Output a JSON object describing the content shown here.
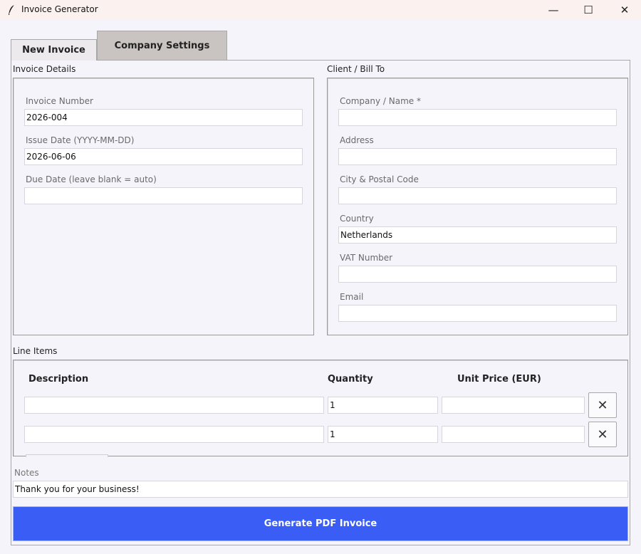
{
  "window": {
    "title": "Invoice Generator",
    "minimize_glyph": "—",
    "maximize_glyph": "☐",
    "close_glyph": "✕"
  },
  "tabs": [
    {
      "label": "New Invoice",
      "active": true
    },
    {
      "label": "Company Settings",
      "active": false
    }
  ],
  "invoice_details": {
    "section_label": "Invoice Details",
    "invoice_number": {
      "label": "Invoice Number",
      "value": "2026-004"
    },
    "issue_date": {
      "label": "Issue Date (YYYY-MM-DD)",
      "value": "2026-06-06"
    },
    "due_date": {
      "label": "Due Date (leave blank = auto)",
      "value": ""
    }
  },
  "client": {
    "section_label": "Client / Bill To",
    "company": {
      "label": "Company / Name *",
      "value": ""
    },
    "address": {
      "label": "Address",
      "value": ""
    },
    "city_postal": {
      "label": "City & Postal Code",
      "value": ""
    },
    "country": {
      "label": "Country",
      "value": "Netherlands"
    },
    "vat": {
      "label": "VAT Number",
      "value": ""
    },
    "email": {
      "label": "Email",
      "value": ""
    }
  },
  "line_items": {
    "section_label": "Line Items",
    "headers": {
      "description": "Description",
      "quantity": "Quantity",
      "unit_price": "Unit Price (EUR)"
    },
    "rows": [
      {
        "description": "",
        "quantity": "1",
        "unit_price": "",
        "remove_glyph": "✕"
      },
      {
        "description": "",
        "quantity": "1",
        "unit_price": "",
        "remove_glyph": "✕"
      }
    ]
  },
  "notes": {
    "label": "Notes",
    "value": "Thank you for your business!"
  },
  "generate_button": {
    "label": "Generate PDF Invoice"
  },
  "colors": {
    "accent": "#3a5ef5",
    "background": "#f5f4fb",
    "titlebar": "#fbf1ee"
  }
}
